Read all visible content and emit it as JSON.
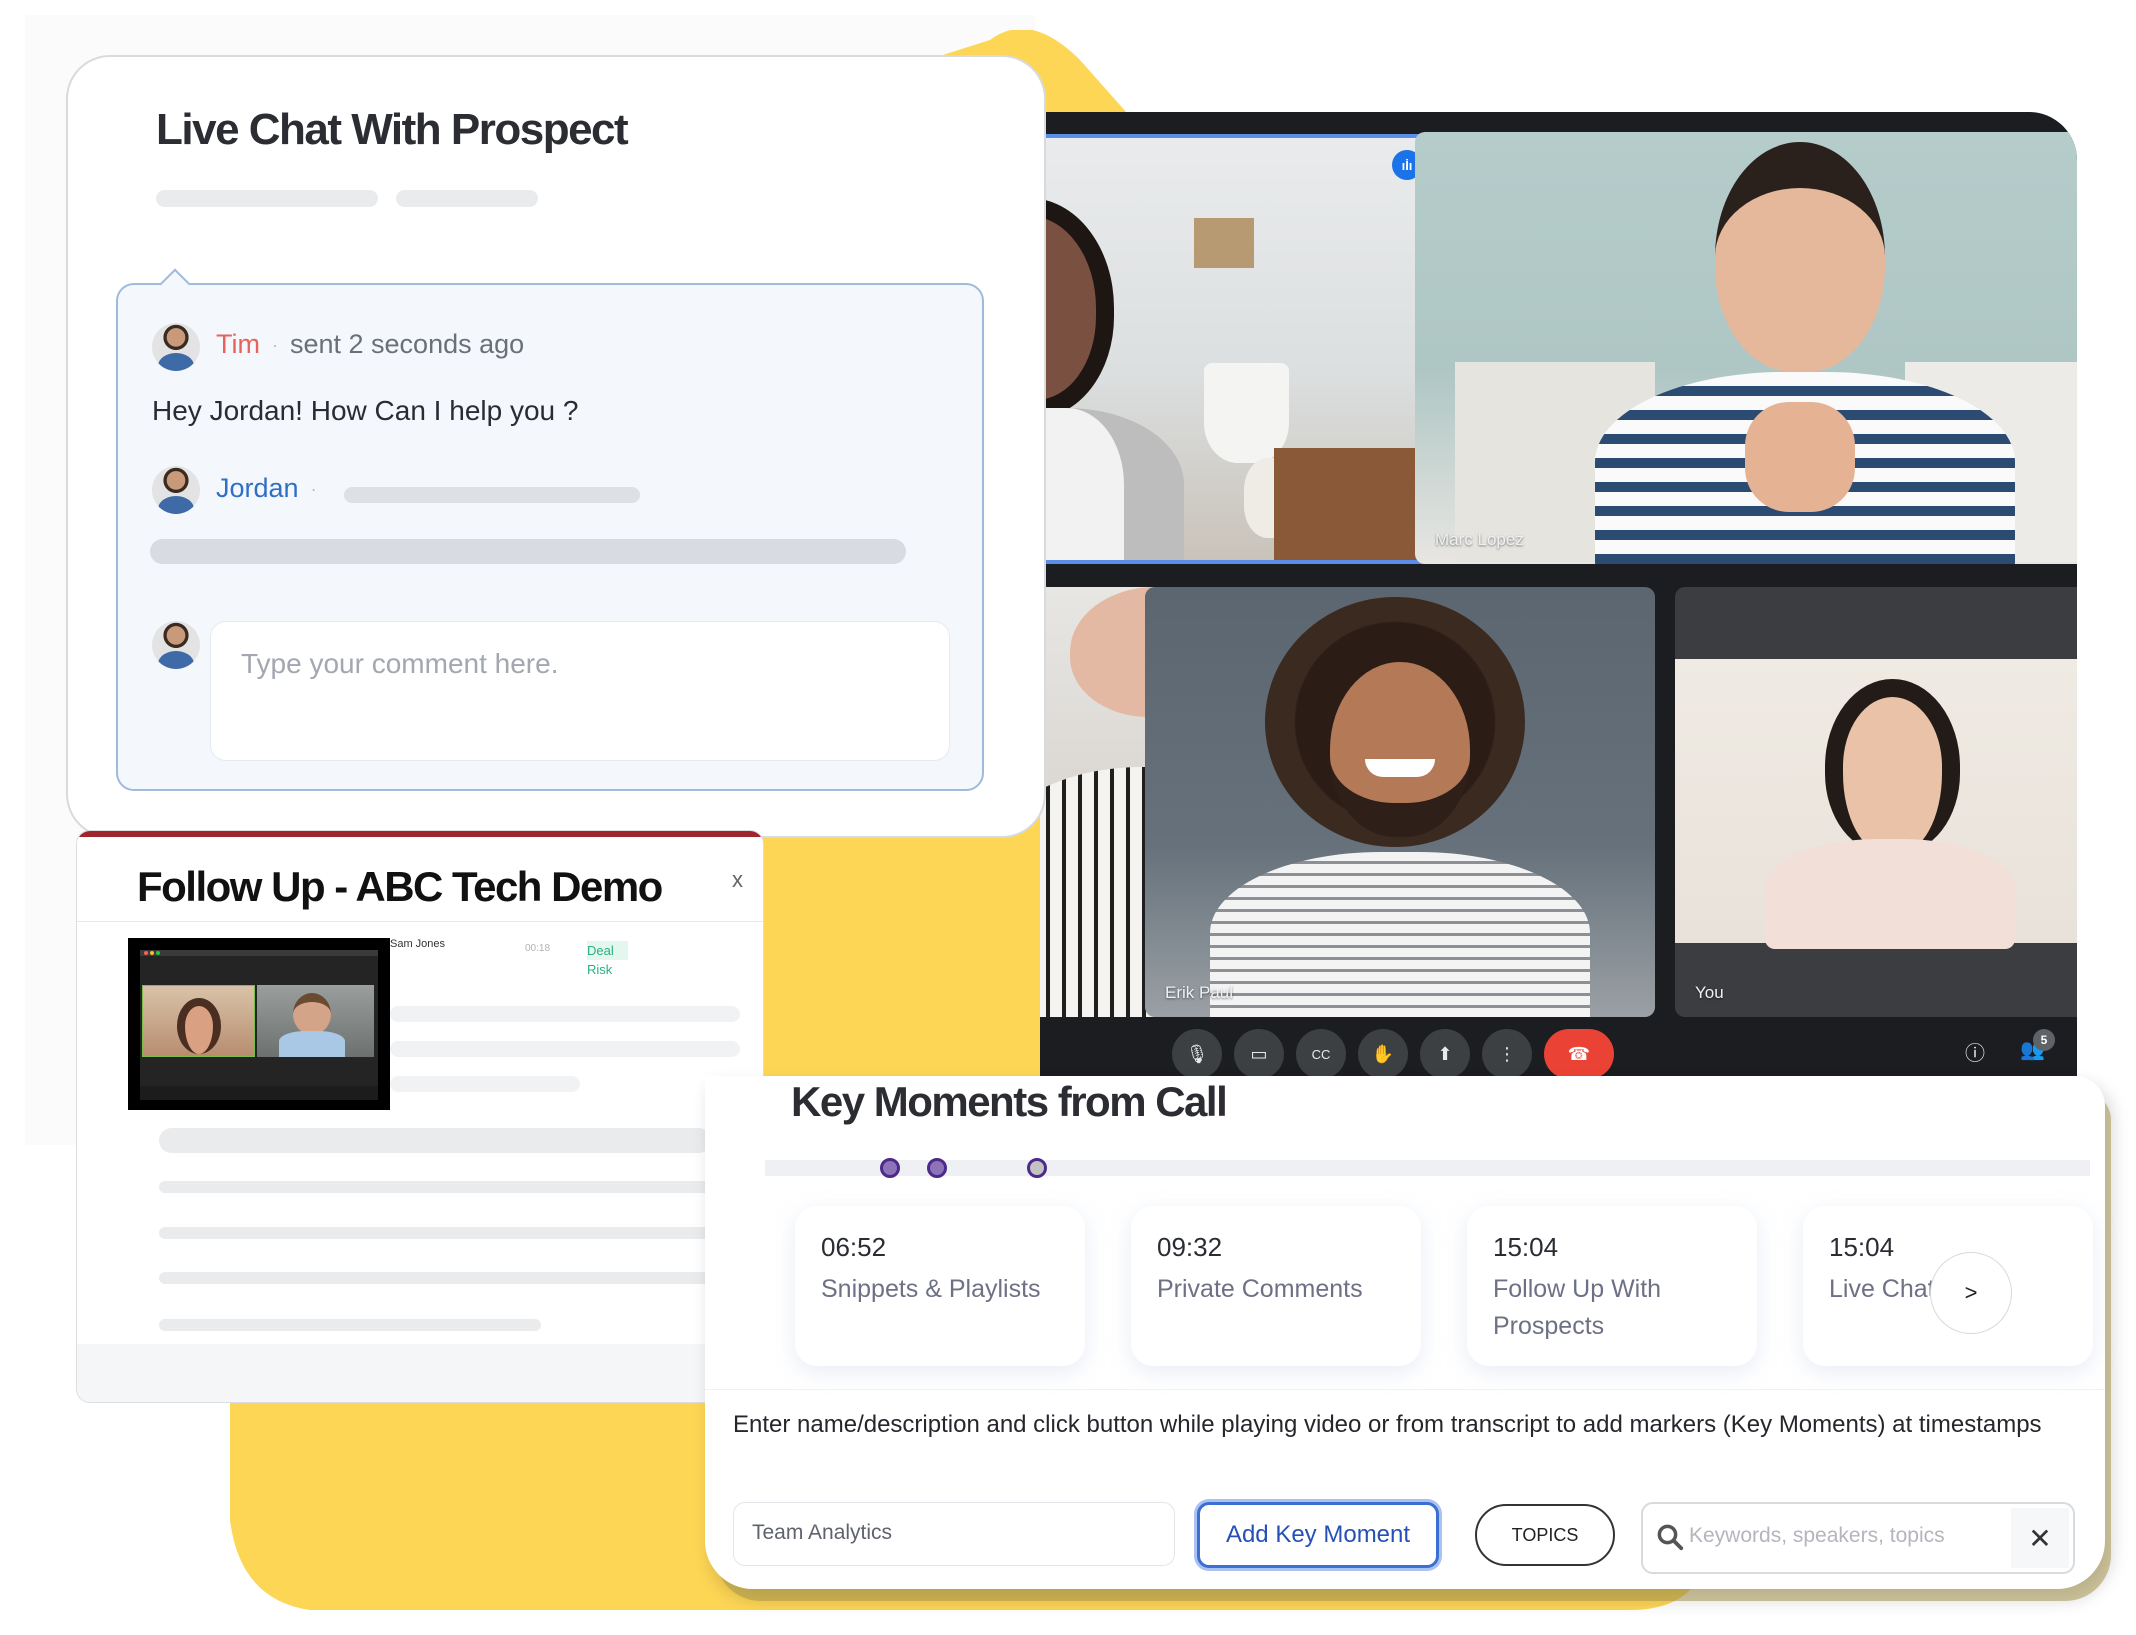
{
  "colors": {
    "yellow": "#fdd655",
    "chat_border": "#9fbadb",
    "tim": "#e7625a",
    "jordan": "#2f6fc6",
    "follow_topbar": "#a0262d",
    "marker_fill": "#8e73b8",
    "marker_stroke": "#4c2a8c",
    "add_button": "#3b6fd4",
    "hangup": "#ea4335"
  },
  "chat": {
    "title": "Live Chat With Prospect",
    "messages": [
      {
        "sender": "Tim",
        "separator": "·",
        "meta": "sent 2 seconds ago",
        "text": "Hey Jordan! How Can I help you ?"
      },
      {
        "sender": "Jordan",
        "separator": "·"
      }
    ],
    "comment_placeholder": "Type your comment here."
  },
  "video_call": {
    "tiles": [
      {
        "name": "",
        "speaking": true
      },
      {
        "name": "Marc Lopez"
      },
      {
        "name": ""
      },
      {
        "name": "Erik Paul"
      },
      {
        "name": "You"
      }
    ],
    "speaking_icon": "audio-wave-icon",
    "controls": [
      {
        "icon": "microphone-icon",
        "glyph": "🎙"
      },
      {
        "icon": "camera-icon",
        "glyph": "▭"
      },
      {
        "icon": "captions-icon",
        "glyph": "CC"
      },
      {
        "icon": "raise-hand-icon",
        "glyph": "✋"
      },
      {
        "icon": "present-icon",
        "glyph": "⬆"
      },
      {
        "icon": "more-icon",
        "glyph": "⋮"
      },
      {
        "icon": "hang-up-icon",
        "glyph": "☎"
      }
    ],
    "info_icon": "ⓘ",
    "people_icon": "👥",
    "participant_count": "5"
  },
  "follow_up": {
    "title": "Follow Up - ABC Tech Demo",
    "close": "x",
    "row": {
      "name": "Sam Jones",
      "time": "00:18",
      "tag_line1": "Deal",
      "tag_line2": "Risk"
    }
  },
  "key_moments": {
    "title": "Key Moments from Call",
    "timeline_markers": [
      {
        "position_fraction": 0.087,
        "current": false
      },
      {
        "position_fraction": 0.122,
        "current": false
      },
      {
        "position_fraction": 0.198,
        "current": true
      }
    ],
    "cards": [
      {
        "time": "06:52",
        "label": "Snippets & Playlists"
      },
      {
        "time": "09:32",
        "label": "Private Comments"
      },
      {
        "time": "15:04",
        "label": "Follow Up With Prospects"
      },
      {
        "time": "15:04",
        "label": "Live Chat"
      }
    ],
    "next_button": ">",
    "help_text": "Enter name/description and click button while playing video or from transcript to add markers (Key Moments) at timestamps",
    "name_input_value": "Team Analytics",
    "add_button": "Add Key Moment",
    "topics_button": "TOPICS",
    "search_placeholder": "Keywords, speakers, topics",
    "clear_button": "✕"
  }
}
